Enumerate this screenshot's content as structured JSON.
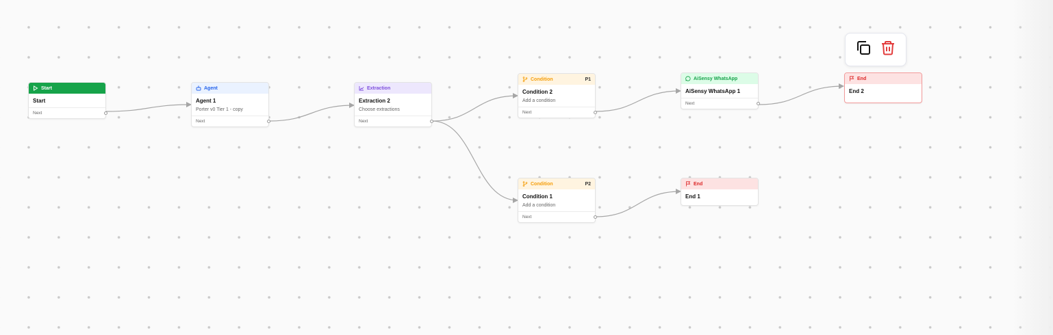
{
  "colors": {
    "start_header": "#16a34a",
    "agent_header": "#eaf2ff",
    "agent_text": "#2563eb",
    "extraction_header": "#ede7fd",
    "extraction_text": "#7c4ddc",
    "condition_header": "#fff4e0",
    "condition_text": "#f59e0b",
    "whatsapp_header": "#dcfce7",
    "whatsapp_text": "#16a34a",
    "end_header": "#fde2e2",
    "end_text": "#dc2626",
    "edge": "#a6a6a6",
    "delete_icon": "#e23b3b"
  },
  "nodes": {
    "start": {
      "type": "Start",
      "title": "Start",
      "next": "Next",
      "icon": "play-icon"
    },
    "agent": {
      "type": "Agent",
      "title": "Agent 1",
      "subtitle": "Porter v0 Tier 1 - copy",
      "next": "Next",
      "icon": "robot-icon"
    },
    "extraction": {
      "type": "Extraction",
      "title": "Extraction 2",
      "subtitle": "Choose extractions",
      "next": "Next",
      "icon": "chart-icon"
    },
    "condition2": {
      "type": "Condition",
      "priority": "P1",
      "title": "Condition 2",
      "subtitle": "Add a condition",
      "next": "Next",
      "icon": "branch-icon"
    },
    "condition1": {
      "type": "Condition",
      "priority": "P2",
      "title": "Condition 1",
      "subtitle": "Add a condition",
      "next": "Next",
      "icon": "branch-icon"
    },
    "whatsapp": {
      "type": "AiSensy WhatsApp",
      "title": "AiSensy WhatsApp 1",
      "next": "Next",
      "icon": "chat-icon"
    },
    "end1": {
      "type": "End",
      "title": "End 1",
      "icon": "flag-icon"
    },
    "end2": {
      "type": "End",
      "title": "End 2",
      "icon": "flag-icon"
    }
  },
  "toolbar": {
    "duplicate_icon": "copy-icon",
    "delete_icon": "trash-icon"
  }
}
